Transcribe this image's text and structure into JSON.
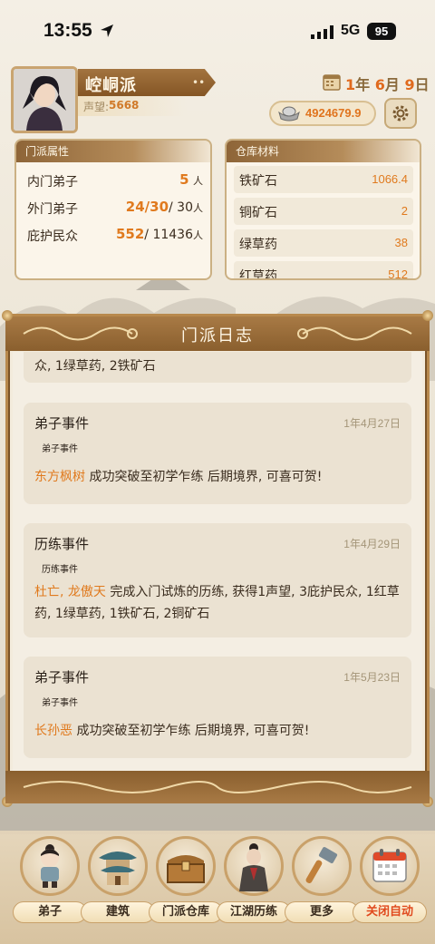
{
  "status_bar": {
    "time": "13:55",
    "network": "5G",
    "battery": "95"
  },
  "header": {
    "sect_name": "崆峒派",
    "name_menu_dots": "••",
    "fame_label": "声望:",
    "fame_value": "5668",
    "date": {
      "year": "1",
      "year_unit": "年",
      "month": "6",
      "month_unit": "月",
      "day": "9",
      "day_unit": "日"
    },
    "money": "4924679.9"
  },
  "sect_panel": {
    "title": "门派属性",
    "rows": [
      {
        "label": "内门弟子",
        "value": "5",
        "unit": "人"
      },
      {
        "label": "外门弟子",
        "value": "24/30",
        "cap": "/ 30",
        "unit": "人"
      },
      {
        "label": "庇护民众",
        "value": "552",
        "cap": "/ 11436",
        "unit": "人"
      }
    ]
  },
  "warehouse_panel": {
    "title": "仓库材料",
    "rows": [
      {
        "label": "铁矿石",
        "value": "1066.4"
      },
      {
        "label": "铜矿石",
        "value": "2"
      },
      {
        "label": "绿草药",
        "value": "38"
      },
      {
        "label": "红草药",
        "value": "512"
      }
    ]
  },
  "log": {
    "title": "门派日志",
    "partial_text": "众, 1绿草药, 2铁矿石",
    "events": [
      {
        "type": "弟子事件",
        "date": "1年4月27日",
        "sub": "弟子事件",
        "who": "东方枫树",
        "text": " 成功突破至初学乍练 后期境界, 可喜可贺!"
      },
      {
        "type": "历练事件",
        "date": "1年4月29日",
        "sub": "历练事件",
        "who": "杜亡, 龙傲天",
        "text": " 完成入门试炼的历练, 获得1声望, 3庇护民众, 1红草药, 1绿草药, 1铁矿石, 2铜矿石"
      },
      {
        "type": "弟子事件",
        "date": "1年5月23日",
        "sub": "弟子事件",
        "who": "长孙恶",
        "text": " 成功突破至初学乍练 后期境界, 可喜可贺!"
      }
    ]
  },
  "nav": [
    {
      "label": "弟子",
      "icon": "disciple-icon"
    },
    {
      "label": "建筑",
      "icon": "pavilion-icon"
    },
    {
      "label": "门派仓库",
      "icon": "chest-icon"
    },
    {
      "label": "江湖历练",
      "icon": "warrior-icon"
    },
    {
      "label": "更多",
      "icon": "hammer-icon"
    },
    {
      "label": "关闭自动",
      "icon": "calendar-icon"
    }
  ],
  "colors": {
    "accent": "#e07a1e",
    "frame": "#b8894d",
    "header_brown": "#8a5f2e"
  }
}
